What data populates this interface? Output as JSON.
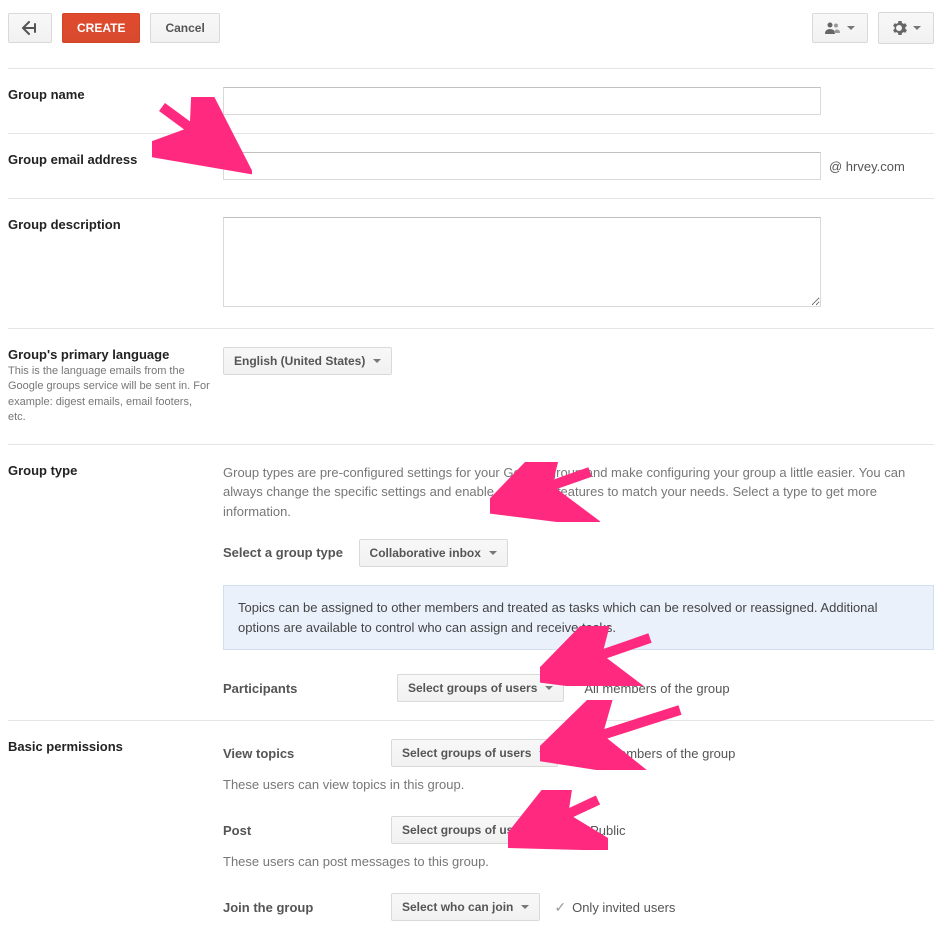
{
  "toolbar": {
    "create_label": "CREATE",
    "cancel_label": "Cancel"
  },
  "fields": {
    "group_name": {
      "label": "Group name",
      "value": ""
    },
    "group_email": {
      "label": "Group email address",
      "value": "",
      "suffix": "@ hrvey.com"
    },
    "group_desc": {
      "label": "Group description",
      "value": ""
    },
    "primary_lang": {
      "label": "Group's primary language",
      "sublabel": "This is the language emails from the Google groups service will be sent in. For example: digest emails, email footers, etc.",
      "selected": "English (United States)"
    },
    "group_type": {
      "label": "Group type",
      "desc": "Group types are pre-configured settings for your Google group and make configuring your group a little easier. You can always change the specific settings and enable additional features to match your needs. Select a type to get more information.",
      "select_label": "Select a group type",
      "selected": "Collaborative inbox",
      "info": "Topics can be assigned to other members and treated as tasks which can be resolved or reassigned. Additional options are available to control who can assign and receive tasks.",
      "participants_label": "Participants",
      "participants_dropdown": "Select groups of users",
      "participants_value": "All members of the group"
    },
    "permissions": {
      "label": "Basic permissions",
      "view_topics": {
        "label": "View topics",
        "dropdown": "Select groups of users",
        "value": "All members of the group",
        "desc": "These users can view topics in this group."
      },
      "post": {
        "label": "Post",
        "dropdown": "Select groups of users",
        "value": "Public",
        "desc": "These users can post messages to this group."
      },
      "join": {
        "label": "Join the group",
        "dropdown": "Select who can join",
        "value": "Only invited users"
      }
    }
  }
}
